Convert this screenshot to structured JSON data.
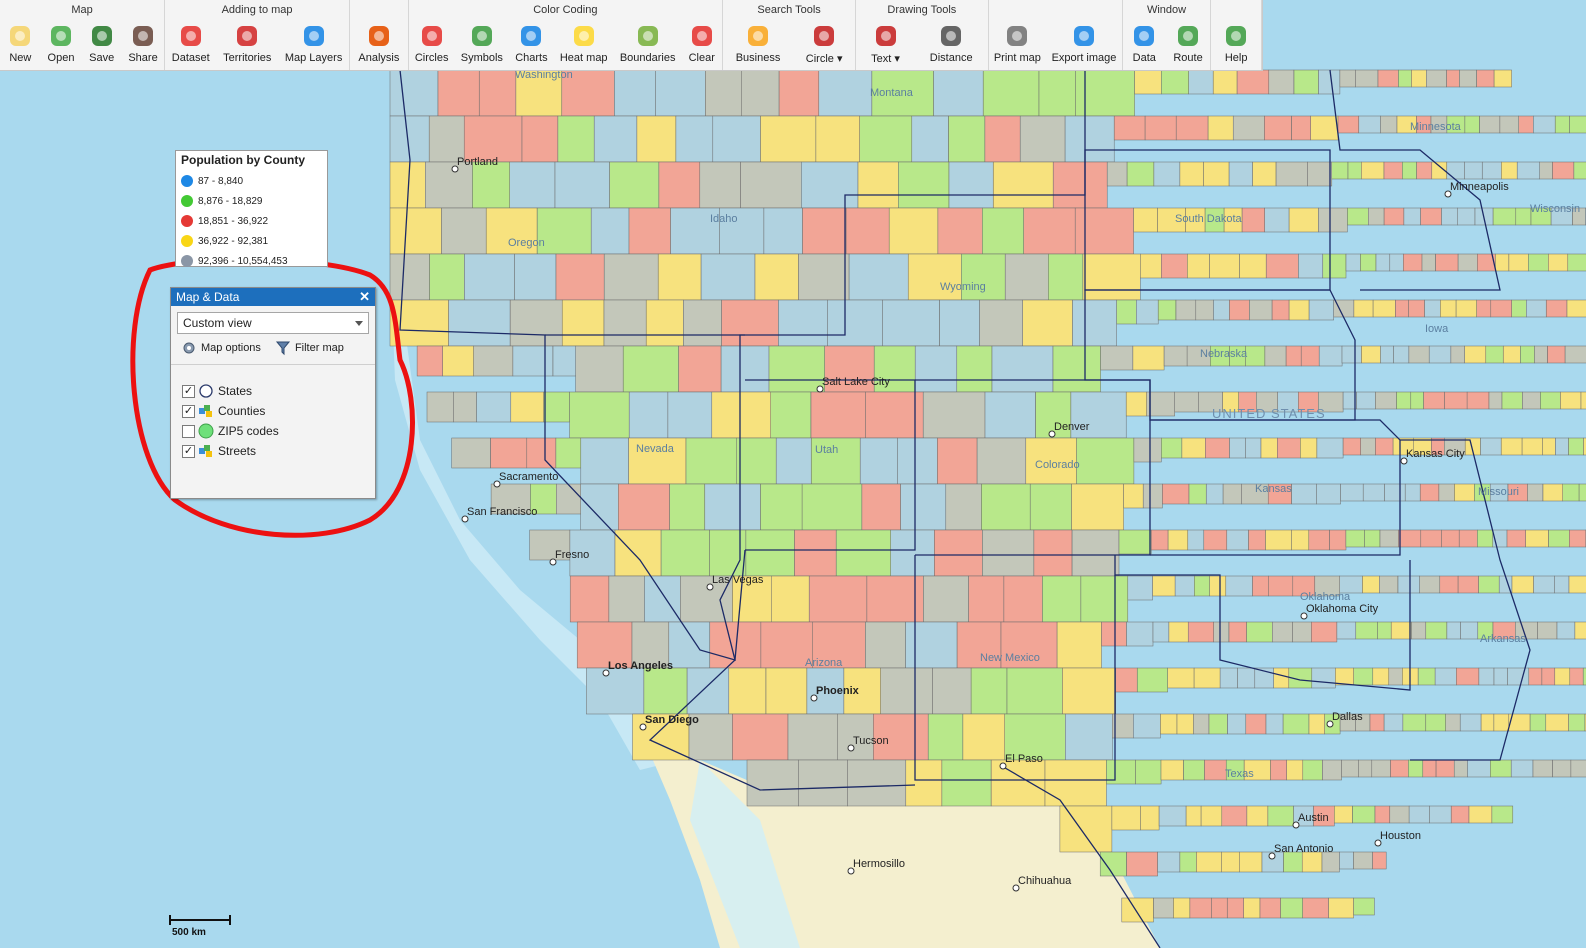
{
  "toolbar": {
    "groups": [
      {
        "title": "Map",
        "items": [
          {
            "label": "New",
            "icon": "new-document-icon"
          },
          {
            "label": "Open",
            "icon": "open-folder-icon"
          },
          {
            "label": "Save",
            "icon": "save-disk-icon"
          },
          {
            "label": "Share",
            "icon": "share-people-icon"
          }
        ]
      },
      {
        "title": "Adding to map",
        "items": [
          {
            "label": "Dataset",
            "icon": "dataset-pin-icon"
          },
          {
            "label": "Territories",
            "icon": "territories-icon"
          },
          {
            "label": "Map Layers",
            "icon": "globe-layers-icon"
          }
        ]
      },
      {
        "title": "",
        "items": [
          {
            "label": "Analysis",
            "icon": "analysis-target-icon"
          }
        ]
      },
      {
        "title": "Color Coding",
        "items": [
          {
            "label": "Circles",
            "icon": "circles-icon"
          },
          {
            "label": "Symbols",
            "icon": "symbols-icon"
          },
          {
            "label": "Charts",
            "icon": "charts-icon"
          },
          {
            "label": "Heat map",
            "icon": "heat-map-icon"
          },
          {
            "label": "Boundaries",
            "icon": "boundaries-icon"
          },
          {
            "label": "Clear",
            "icon": "clear-x-icon"
          }
        ]
      },
      {
        "title": "Search Tools",
        "items": [
          {
            "label": "Business",
            "icon": "business-binoculars-icon"
          },
          {
            "label": "Circle",
            "icon": "circle-search-icon",
            "dropdown": true
          }
        ]
      },
      {
        "title": "Drawing Tools",
        "items": [
          {
            "label": "Text",
            "icon": "text-box-icon",
            "dropdown": true
          },
          {
            "label": "Distance",
            "icon": "ruler-icon"
          }
        ]
      },
      {
        "title": "",
        "items": [
          {
            "label": "Print map",
            "icon": "printer-icon"
          },
          {
            "label": "Export image",
            "icon": "export-globe-icon"
          }
        ]
      },
      {
        "title": "Window",
        "items": [
          {
            "label": "Data",
            "icon": "data-grid-icon"
          },
          {
            "label": "Route",
            "icon": "route-car-icon"
          }
        ]
      },
      {
        "title": "",
        "items": [
          {
            "label": "Help",
            "icon": "help-icon"
          }
        ]
      }
    ]
  },
  "legend": {
    "title": "Population by County",
    "items": [
      {
        "label": "87 - 8,840",
        "color": "#1e88e5"
      },
      {
        "label": "8,876 - 18,829",
        "color": "#43c934"
      },
      {
        "label": "18,851 - 36,922",
        "color": "#e53935"
      },
      {
        "label": "36,922 - 92,381",
        "color": "#f9d616"
      },
      {
        "label": "92,396 - 10,554,453",
        "color": "#8a96a6"
      }
    ]
  },
  "panel": {
    "title": "Map & Data",
    "view_select": "Custom view",
    "map_options": "Map options",
    "filter_map": "Filter map",
    "layers": [
      {
        "label": "States",
        "checked": true
      },
      {
        "label": "Counties",
        "checked": true
      },
      {
        "label": "ZIP5 codes",
        "checked": false
      },
      {
        "label": "Streets",
        "checked": true
      }
    ]
  },
  "map": {
    "cities": [
      "Portland",
      "Sacramento",
      "San Francisco",
      "Fresno",
      "Las Vegas",
      "Los Angeles",
      "San Diego",
      "Salt Lake City",
      "Phoenix",
      "Tucson",
      "Denver",
      "El Paso",
      "Hermosillo",
      "Chihuahua",
      "Minneapolis",
      "Kansas City",
      "Oklahoma City",
      "Dallas",
      "Austin",
      "San Antonio",
      "Houston"
    ],
    "states": [
      "Washington",
      "Oregon",
      "Idaho",
      "Montana",
      "Wyoming",
      "Nevada",
      "Utah",
      "Colorado",
      "Arizona",
      "New Mexico",
      "Texas",
      "Kansas",
      "Nebraska",
      "South Dakota",
      "Minnesota",
      "Iowa",
      "Missouri",
      "Oklahoma",
      "Arkansas",
      "Wisconsin"
    ],
    "country": "UNITED STATES",
    "scale": "500 km",
    "county_colors": [
      "#b0d2e0",
      "#b8e88a",
      "#f2a596",
      "#f7e27e",
      "#c3c7ba"
    ]
  }
}
